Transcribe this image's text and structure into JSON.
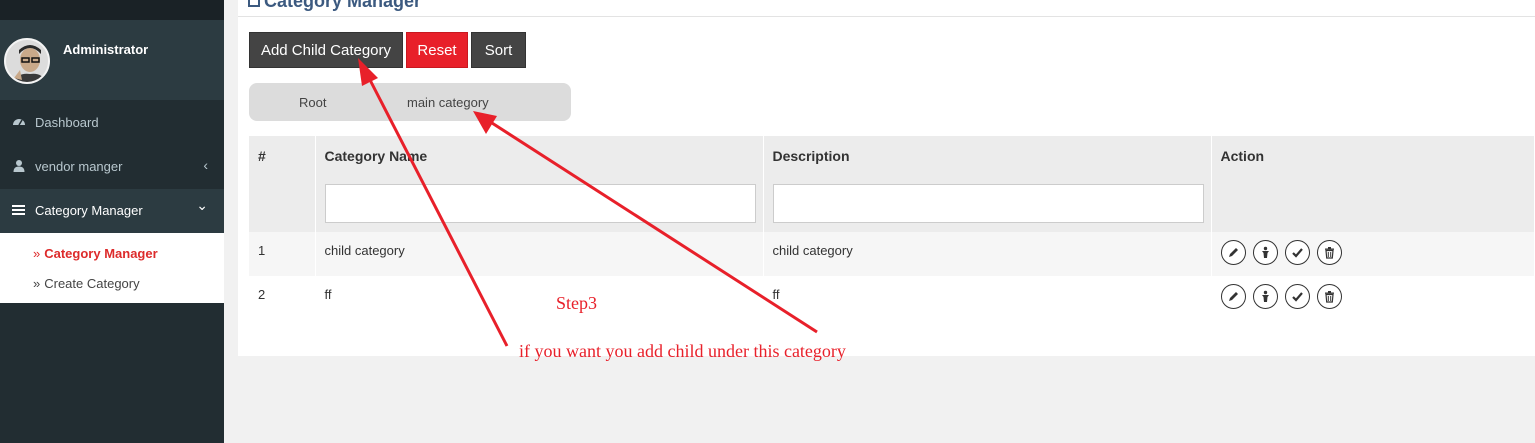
{
  "sidebar": {
    "user_name": "Administrator",
    "items": [
      {
        "label": "Dashboard",
        "icon": "dashboard-icon"
      },
      {
        "label": "vendor manger",
        "icon": "user-icon"
      },
      {
        "label": "Category Manager",
        "icon": "bars-icon"
      }
    ],
    "sub_items": [
      {
        "label": "Category Manager",
        "current": true
      },
      {
        "label": "Create Category",
        "current": false
      }
    ],
    "chevron_collapsed": "‹",
    "chevron_expanded": "⌄",
    "sub_marker": "»"
  },
  "page": {
    "title": "Category Manager"
  },
  "toolbar": {
    "add_child_label": "Add Child Category",
    "reset_label": "Reset",
    "sort_label": "Sort"
  },
  "breadcrumb": {
    "root": "Root",
    "current": "main category"
  },
  "table": {
    "headers": [
      "#",
      "Category Name",
      "Description",
      "Action"
    ],
    "rows": [
      {
        "num": "1",
        "name": "child category",
        "description": "child category"
      },
      {
        "num": "2",
        "name": "ff",
        "description": "ff"
      }
    ]
  },
  "annotations": {
    "step": "Step3",
    "hint": "if you want you add child under this category"
  },
  "colors": {
    "sidebar_bg": "#222d32",
    "accent_red": "#e8202a",
    "button_dark": "#444444",
    "title_blue": "#3c5a80"
  }
}
